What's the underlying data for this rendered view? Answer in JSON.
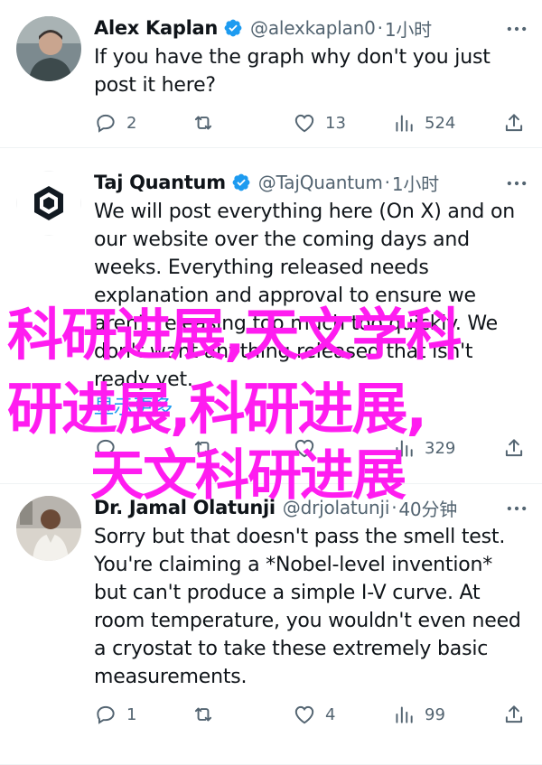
{
  "tweets": [
    {
      "name": "Alex Kaplan",
      "handle": "@alexkaplan0",
      "sep": "·",
      "time": "1小时",
      "lines": [
        "If you have the graph why don't you just",
        "post it here?"
      ],
      "reply_count": "2",
      "retweet_count": "",
      "like_count": "13",
      "views_count": "524"
    },
    {
      "name": "Taj Quantum",
      "handle": "@TajQuantum",
      "sep": "·",
      "time": "1小时",
      "lines": [
        "We will post everything here (On X) and on",
        "our website over the coming days and",
        "weeks. Everything released needs",
        "explanation and approval to ensure we",
        "aren't releasing too much too quickly. We",
        "don't want anything released that isn't",
        "ready yet.",
        "显示更多"
      ],
      "reply_count": "",
      "retweet_count": "",
      "like_count": "",
      "views_count": "329"
    },
    {
      "name": "Dr. Jamal Olatunji",
      "handle": "@drjolatunji",
      "sep": "·",
      "time": "40分钟",
      "lines": [
        "Sorry but that doesn't pass the smell test.",
        "You're claiming a *Nobel-level invention*",
        "but can't produce a simple I-V curve. At",
        "room temperature, you wouldn't even need",
        "a cryostat to take these extremely basic",
        "measurements."
      ],
      "reply_count": "1",
      "retweet_count": "",
      "like_count": "4",
      "views_count": "99"
    }
  ],
  "overlay": {
    "line1": "科研进展,天文学科",
    "line2": "研进展,科研进展,",
    "line3": "天文科研进展"
  },
  "colors": {
    "verified": "#1d9bf0",
    "text": "#0f1419",
    "secondary": "#536471",
    "link": "#1d9bf0",
    "overlay": "#ff1cf0",
    "divider": "#eff3f4"
  },
  "icons": {
    "reply": "reply-icon",
    "retweet": "retweet-icon",
    "like": "like-icon",
    "views": "views-icon",
    "share": "share-icon",
    "more": "more-icon",
    "verified": "verified-badge-icon"
  }
}
